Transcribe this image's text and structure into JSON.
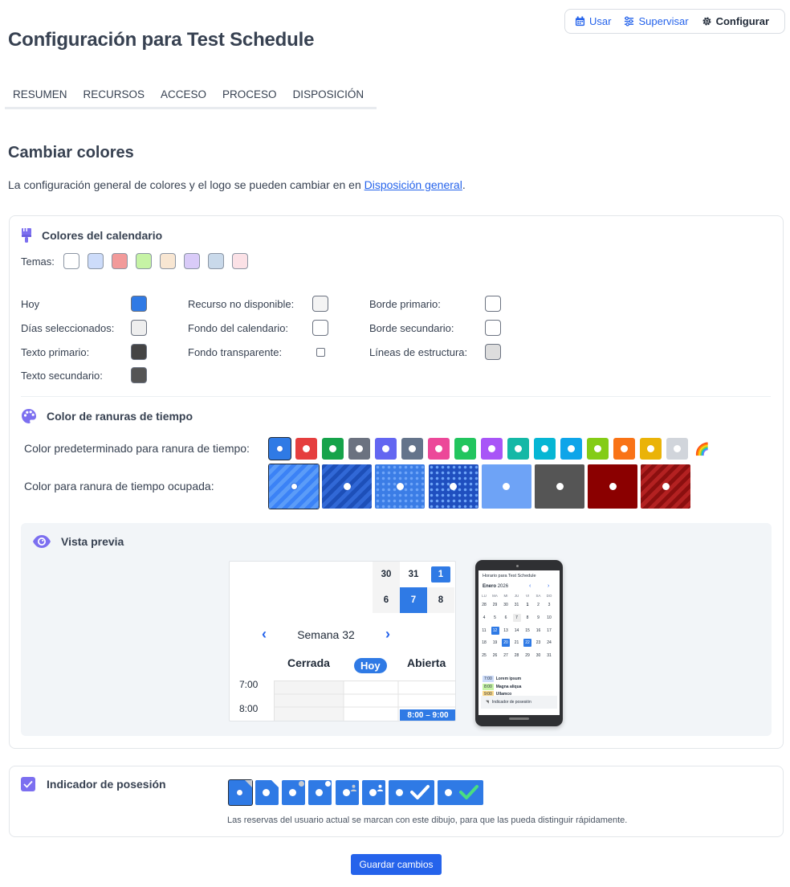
{
  "nav": {
    "use": "Usar",
    "supervise": "Supervisar",
    "configure": "Configurar"
  },
  "page_title": "Configuración para Test Schedule",
  "tabs": [
    "RESUMEN",
    "RECURSOS",
    "ACCESO",
    "PROCESO",
    "DISPOSICIÓN"
  ],
  "section": {
    "title": "Cambiar colores",
    "intro_before": "La configuración general de colores y el logo se pueden cambiar en en ",
    "intro_link": "Disposición general",
    "intro_after": "."
  },
  "calendar_colors": {
    "heading": "Colores del calendario",
    "themes_label": "Temas:",
    "themes": [
      "#ffffff",
      "#cddcfa",
      "#f29a9a",
      "#c6f3a5",
      "#f8e6d2",
      "#d9cbf8",
      "#c9d9ea",
      "#fbe1e6"
    ],
    "col1": [
      {
        "label": "Hoy",
        "color": "#2f7ae5"
      },
      {
        "label": "Días seleccionados:",
        "color": "#eeeeee"
      },
      {
        "label": "Texto primario:",
        "color": "#444444"
      },
      {
        "label": "Texto secundario:",
        "color": "#555555"
      }
    ],
    "col2": [
      {
        "label": "Recurso no disponible:",
        "color": "#f4f4f4"
      },
      {
        "label": "Fondo del calendario:",
        "color": "#ffffff"
      },
      {
        "label": "Fondo transparente:",
        "color": "#ffffff"
      }
    ],
    "col3": [
      {
        "label": "Borde primario:",
        "color": "#ffffff"
      },
      {
        "label": "Borde secundario:",
        "color": "#ffffff"
      },
      {
        "label": "Líneas de estructura:",
        "color": "#dddddd"
      }
    ]
  },
  "slot_colors": {
    "heading": "Color de ranuras de tiempo",
    "default_label": "Color predeterminado para ranura de tiempo:",
    "default_colors": [
      "#2f7ae5",
      "#e53e3e",
      "#16a34a",
      "#6b7280",
      "#6366f1",
      "#64748b",
      "#ec4899",
      "#22c55e",
      "#a855f7",
      "#14b8a6",
      "#06b6d4",
      "#0ea5e9",
      "#84cc16",
      "#f97316",
      "#eab308",
      "#d1d5db"
    ],
    "rainbow": "🌈",
    "busy_label": "Color para ranura de tiempo ocupada:",
    "busy_styles": [
      "diagonal-light",
      "diagonal-dark",
      "dots-light",
      "dots-dark",
      "light-blue",
      "dark-gray",
      "dark-red",
      "red-stripes"
    ]
  },
  "preview": {
    "heading": "Vista previa",
    "days_top": [
      "30",
      "31",
      "1"
    ],
    "days_bottom": [
      "6",
      "7",
      "8"
    ],
    "week": "Semana 32",
    "headers": {
      "closed": "Cerrada",
      "today": "Hoy",
      "open": "Abierta"
    },
    "times": [
      "7:00",
      "8:00"
    ],
    "booked": "8:00 – 9:00",
    "phone": {
      "title": "Horario para Test Schedule",
      "month": "Enero",
      "year": "2026",
      "dow": [
        "LU",
        "MA",
        "MI",
        "JU",
        "VI",
        "SA",
        "DO"
      ],
      "weeks": [
        [
          "28",
          "29",
          "30",
          "31",
          "1",
          "2",
          "3"
        ],
        [
          "4",
          "5",
          "6",
          "7",
          "8",
          "9",
          "10"
        ],
        [
          "11",
          "12",
          "13",
          "14",
          "15",
          "16",
          "17"
        ],
        [
          "18",
          "19",
          "20",
          "21",
          "22",
          "23",
          "24"
        ],
        [
          "25",
          "26",
          "27",
          "28",
          "29",
          "30",
          "31"
        ]
      ],
      "events": [
        {
          "time": "7:00",
          "label": "Lorem ipsum",
          "color": "#cddcfa"
        },
        {
          "time": "8:00",
          "label": "Magna aliqua",
          "color": "#c6f3a5"
        },
        {
          "time": "9:00",
          "label": "Ullamco",
          "color": "#f9d88a"
        }
      ],
      "indicator": "Indicador de posesión"
    }
  },
  "possession": {
    "heading": "Indicador de posesión",
    "description": "Las reservas del usuario actual se marcan con este dibujo, para que las pueda distinguir rápidamente.",
    "styles": [
      "corner-fold",
      "dog-ear",
      "knob",
      "knob-corner",
      "user",
      "user-corner",
      "check-white",
      "check-green"
    ]
  },
  "save_label": "Guardar cambios"
}
